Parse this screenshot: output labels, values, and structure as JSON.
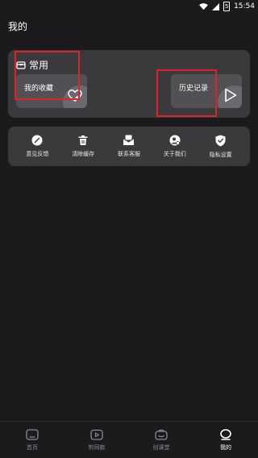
{
  "status_bar": {
    "time": "15:54",
    "battery": "5"
  },
  "page": {
    "title": "我的"
  },
  "common": {
    "title": "常用",
    "tiles": [
      {
        "label": "我的收藏",
        "icon": "heart-icon"
      },
      {
        "label": "历史记录",
        "icon": "play-icon"
      }
    ]
  },
  "tools": [
    {
      "label": "意见反馈",
      "icon": "feedback-pen-icon"
    },
    {
      "label": "清除缓存",
      "icon": "trash-icon"
    },
    {
      "label": "联系客服",
      "icon": "mail-icon"
    },
    {
      "label": "关于我们",
      "icon": "about-info-icon"
    },
    {
      "label": "隐私设置",
      "icon": "shield-check-icon"
    }
  ],
  "bottom_nav": [
    {
      "label": "首页",
      "icon": "home-icon",
      "active": false
    },
    {
      "label": "剪同款",
      "icon": "video-template-icon",
      "active": false
    },
    {
      "label": "创课堂",
      "icon": "classroom-icon",
      "active": false
    },
    {
      "label": "我的",
      "icon": "profile-icon",
      "active": true
    }
  ],
  "colors": {
    "background": "#1b1b1d",
    "card": "#3a3a3d",
    "tile": "#515154",
    "highlight": "#e0212b"
  }
}
